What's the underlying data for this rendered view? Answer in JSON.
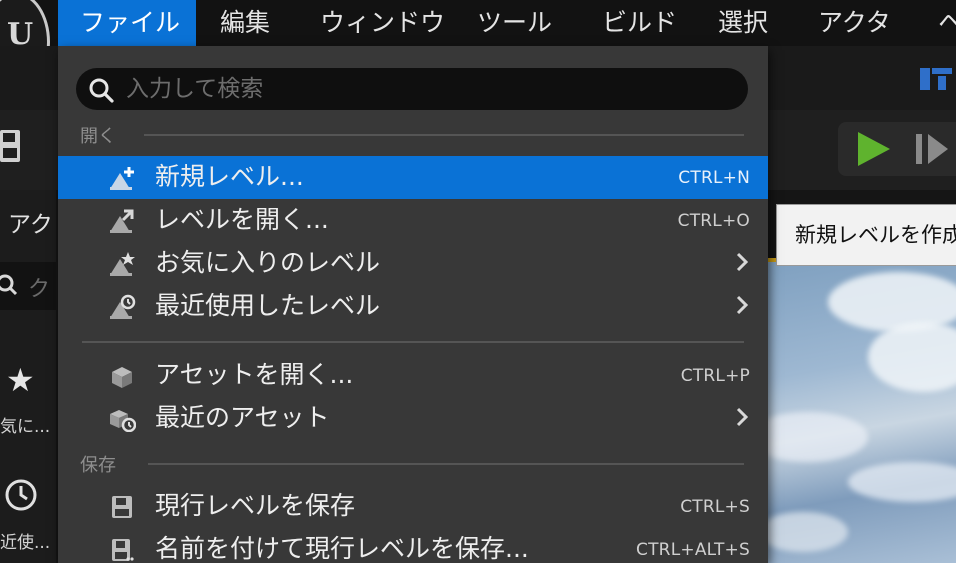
{
  "menubar": {
    "items": [
      {
        "label": "ファイル",
        "active": true
      },
      {
        "label": "編集"
      },
      {
        "label": "ウィンドウ"
      },
      {
        "label": "ツール"
      },
      {
        "label": "ビルド"
      },
      {
        "label": "選択"
      },
      {
        "label": "アクタ"
      },
      {
        "label": "ヘ"
      }
    ]
  },
  "background": {
    "actor_tab_label": "アク",
    "search_placeholder_partial": "ク",
    "favorites_label": "気に...",
    "recent_label": "近使..."
  },
  "tooltip": {
    "text": "新規レベルを作成"
  },
  "file_menu": {
    "search_placeholder": "入力して検索",
    "sections": {
      "open": "開く",
      "save": "保存"
    },
    "items": [
      {
        "label": "新規レベル...",
        "shortcut": "CTRL+N",
        "icon": "new-level-icon",
        "highlighted": true
      },
      {
        "label": "レベルを開く...",
        "shortcut": "CTRL+O",
        "icon": "open-level-icon"
      },
      {
        "label": "お気に入りのレベル",
        "submenu": true,
        "icon": "favorite-levels-icon"
      },
      {
        "label": "最近使用したレベル",
        "submenu": true,
        "icon": "recent-levels-icon"
      },
      {
        "label": "アセットを開く...",
        "shortcut": "CTRL+P",
        "icon": "open-asset-icon"
      },
      {
        "label": "最近のアセット",
        "submenu": true,
        "icon": "recent-assets-icon"
      },
      {
        "label": "現行レベルを保存",
        "shortcut": "CTRL+S",
        "icon": "save-icon"
      },
      {
        "label": "名前を付けて現行レベルを保存...",
        "shortcut": "CTRL+ALT+S",
        "icon": "save-as-icon"
      }
    ]
  },
  "colors": {
    "accent": "#0a72d6",
    "menu_bg": "#383838",
    "play_green": "#5fb32e"
  }
}
